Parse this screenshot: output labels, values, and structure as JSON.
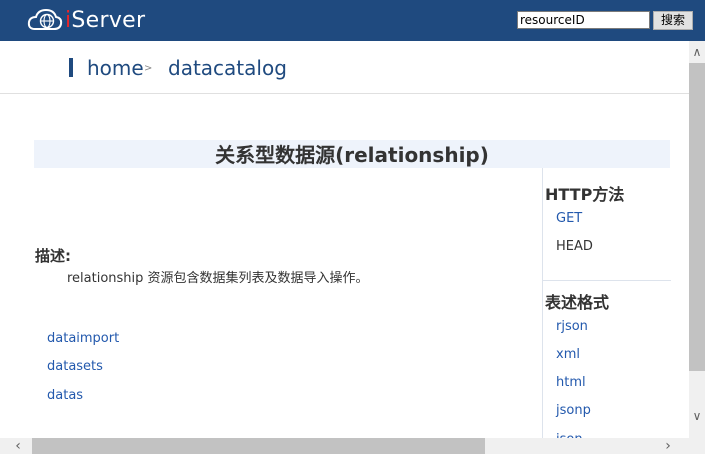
{
  "header": {
    "logo_prefix": "i",
    "logo_suffix": "Server",
    "search_value": "resourceID",
    "search_button": "搜索"
  },
  "breadcrumb": {
    "home": "home",
    "separator": ">",
    "current": "datacatalog"
  },
  "main": {
    "title": "关系型数据源(relationship)",
    "description_heading": "描述:",
    "description_text": "relationship 资源包含数据集列表及数据导入操作。",
    "child_links": [
      "dataimport",
      "datasets",
      "datas"
    ]
  },
  "sidebar": {
    "http_heading": "HTTP方法",
    "http_methods": [
      "GET",
      "HEAD"
    ],
    "format_heading": "表述格式",
    "formats": [
      "rjson",
      "xml",
      "html",
      "jsonp",
      "json"
    ]
  },
  "colors": {
    "header_bg": "#1f4a7f",
    "link": "#2359ad",
    "title_band": "#eef3fb"
  }
}
